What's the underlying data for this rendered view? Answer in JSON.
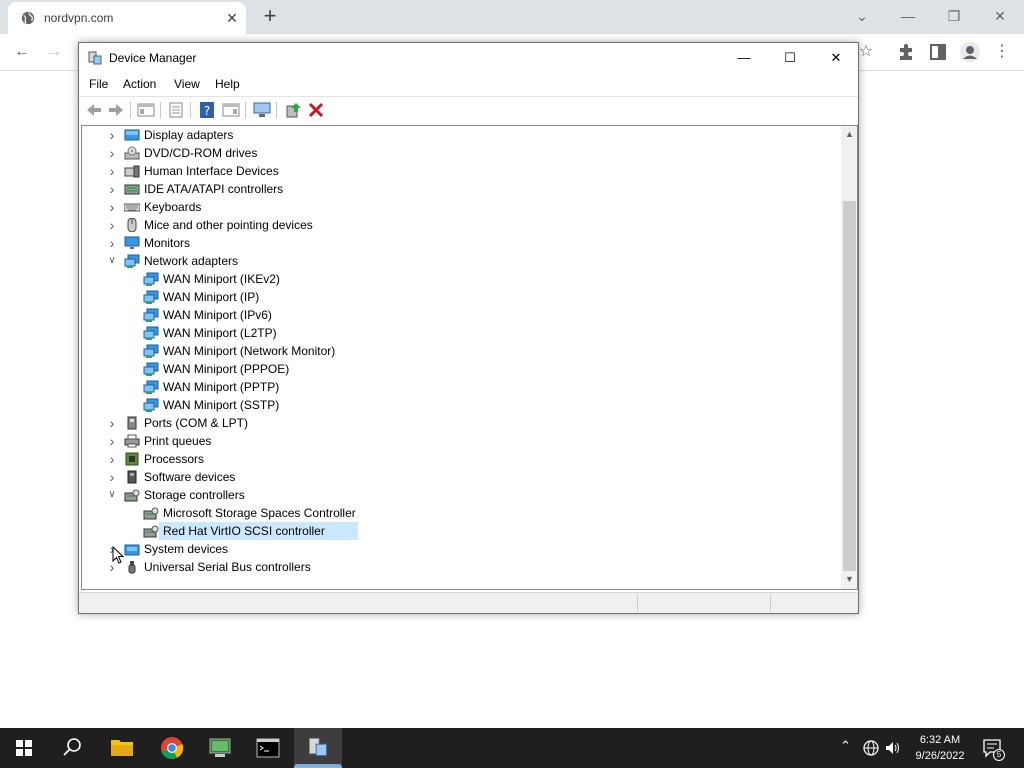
{
  "browser": {
    "tab_title": "nordvpn.com",
    "tab_close": "✕",
    "new_tab": "+",
    "controls": {
      "collapse": "⌄",
      "minimize": "—",
      "restore": "❐",
      "close": "✕"
    }
  },
  "window": {
    "title": "Device Manager",
    "controls": {
      "minimize": "—",
      "maximize": "☐",
      "close": "✕"
    },
    "menu": [
      "File",
      "Action",
      "View",
      "Help"
    ]
  },
  "tree": {
    "nodes": [
      {
        "label": "Display adapters",
        "level": 0,
        "state": "collapsed",
        "icon": "display-adapter-icon"
      },
      {
        "label": "DVD/CD-ROM drives",
        "level": 0,
        "state": "collapsed",
        "icon": "dvd-drive-icon"
      },
      {
        "label": "Human Interface Devices",
        "level": 0,
        "state": "collapsed",
        "icon": "hid-icon"
      },
      {
        "label": "IDE ATA/ATAPI controllers",
        "level": 0,
        "state": "collapsed",
        "icon": "ide-controller-icon"
      },
      {
        "label": "Keyboards",
        "level": 0,
        "state": "collapsed",
        "icon": "keyboard-icon"
      },
      {
        "label": "Mice and other pointing devices",
        "level": 0,
        "state": "collapsed",
        "icon": "mouse-icon"
      },
      {
        "label": "Monitors",
        "level": 0,
        "state": "collapsed",
        "icon": "monitor-icon"
      },
      {
        "label": "Network adapters",
        "level": 0,
        "state": "expanded",
        "icon": "network-adapter-icon"
      },
      {
        "label": "WAN Miniport (IKEv2)",
        "level": 1,
        "icon": "network-adapter-icon"
      },
      {
        "label": "WAN Miniport (IP)",
        "level": 1,
        "icon": "network-adapter-icon"
      },
      {
        "label": "WAN Miniport (IPv6)",
        "level": 1,
        "icon": "network-adapter-icon"
      },
      {
        "label": "WAN Miniport (L2TP)",
        "level": 1,
        "icon": "network-adapter-icon"
      },
      {
        "label": "WAN Miniport (Network Monitor)",
        "level": 1,
        "icon": "network-adapter-icon"
      },
      {
        "label": "WAN Miniport (PPPOE)",
        "level": 1,
        "icon": "network-adapter-icon"
      },
      {
        "label": "WAN Miniport (PPTP)",
        "level": 1,
        "icon": "network-adapter-icon"
      },
      {
        "label": "WAN Miniport (SSTP)",
        "level": 1,
        "icon": "network-adapter-icon"
      },
      {
        "label": "Ports (COM & LPT)",
        "level": 0,
        "state": "collapsed",
        "icon": "port-icon"
      },
      {
        "label": "Print queues",
        "level": 0,
        "state": "collapsed",
        "icon": "printer-icon"
      },
      {
        "label": "Processors",
        "level": 0,
        "state": "collapsed",
        "icon": "processor-icon"
      },
      {
        "label": "Software devices",
        "level": 0,
        "state": "collapsed",
        "icon": "software-device-icon"
      },
      {
        "label": "Storage controllers",
        "level": 0,
        "state": "expanded",
        "icon": "storage-controller-icon"
      },
      {
        "label": "Microsoft Storage Spaces Controller",
        "level": 1,
        "icon": "storage-controller-icon"
      },
      {
        "label": "Red Hat VirtIO SCSI controller",
        "level": 1,
        "icon": "storage-controller-icon",
        "selected": true
      },
      {
        "label": "System devices",
        "level": 0,
        "state": "collapsed",
        "icon": "system-device-icon"
      },
      {
        "label": "Universal Serial Bus controllers",
        "level": 0,
        "state": "collapsed",
        "icon": "usb-icon"
      }
    ]
  },
  "taskbar": {
    "apps": [
      "start-button",
      "search-icon",
      "file-explorer-icon",
      "chrome-icon",
      "network-config-icon",
      "terminal-icon",
      "device-manager-icon"
    ],
    "time": "6:32 AM",
    "date": "9/26/2022",
    "notifications": "5"
  },
  "colors": {
    "selection": "#cce8ff",
    "network_icon": "#3a96dd"
  }
}
